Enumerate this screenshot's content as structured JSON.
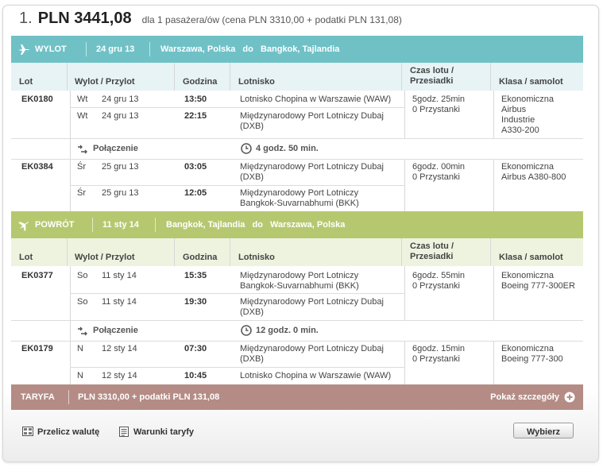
{
  "header": {
    "number": "1.",
    "price": "PLN 3441,08",
    "description": "dla 1 pasażera/ów (cena PLN 3310,00 + podatki PLN 131,08)"
  },
  "outbound": {
    "label": "WYLOT",
    "date": "24 gru 13",
    "from": "Warszawa, Polska",
    "to_word": "do",
    "to": "Bangkok, Tajlandia"
  },
  "inbound": {
    "label": "POWRÓT",
    "date": "11 sty 14",
    "from": "Bangkok, Tajlandia",
    "to_word": "do",
    "to": "Warszawa, Polska"
  },
  "columns": {
    "flight": "Lot",
    "depart_arrive": "Wylot / Przylot",
    "time": "Godzina",
    "airport": "Lotnisko",
    "duration_line1": "Czas lotu /",
    "duration_line2": "Przesiadki",
    "class": "Klasa / samolot"
  },
  "outbound_segments": [
    {
      "flight": "EK0180",
      "dep": {
        "day": "Wt",
        "date": "24 gru 13",
        "time": "13:50",
        "airport": "Lotnisko Chopina w Warszawie (WAW)"
      },
      "arr": {
        "day": "Wt",
        "date": "24 gru 13",
        "time": "22:15",
        "airport_l1": "Międzynarodowy Port Lotniczy Dubaj",
        "airport_l2": "(DXB)"
      },
      "duration": "5godz. 25min",
      "stops": "0 Przystanki",
      "class": "Ekonomiczna",
      "aircraft_l1": "Airbus",
      "aircraft_l2": "Industrie",
      "aircraft_l3": "A330-200"
    },
    {
      "flight": "EK0384",
      "dep": {
        "day": "Śr",
        "date": "25 gru 13",
        "time": "03:05",
        "airport_l1": "Międzynarodowy Port Lotniczy Dubaj",
        "airport_l2": "(DXB)"
      },
      "arr": {
        "day": "Śr",
        "date": "25 gru 13",
        "time": "12:05",
        "airport_l1": "Międzynarodowy Port Lotniczy",
        "airport_l2": "Bangkok-Suvarnabhumi (BKK)"
      },
      "duration": "6godz. 00min",
      "stops": "0 Przystanki",
      "class": "Ekonomiczna",
      "aircraft_l1": "Airbus A380-800"
    }
  ],
  "outbound_connection": {
    "label": "Połączenie",
    "time": "4 godz. 50 min."
  },
  "inbound_segments": [
    {
      "flight": "EK0377",
      "dep": {
        "day": "So",
        "date": "11 sty 14",
        "time": "15:35",
        "airport_l1": "Międzynarodowy Port Lotniczy",
        "airport_l2": "Bangkok-Suvarnabhumi (BKK)"
      },
      "arr": {
        "day": "So",
        "date": "11 sty 14",
        "time": "19:30",
        "airport_l1": "Międzynarodowy Port Lotniczy Dubaj",
        "airport_l2": "(DXB)"
      },
      "duration": "6godz. 55min",
      "stops": "0 Przystanki",
      "class": "Ekonomiczna",
      "aircraft_l1": "Boeing 777-300ER"
    },
    {
      "flight": "EK0179",
      "dep": {
        "day": "N",
        "date": "12 sty 14",
        "time": "07:30",
        "airport_l1": "Międzynarodowy Port Lotniczy Dubaj",
        "airport_l2": "(DXB)"
      },
      "arr": {
        "day": "N",
        "date": "12 sty 14",
        "time": "10:45",
        "airport": "Lotnisko Chopina w Warszawie (WAW)"
      },
      "duration": "6godz. 15min",
      "stops": "0 Przystanki",
      "class": "Ekonomiczna",
      "aircraft_l1": "Boeing 777-300"
    }
  ],
  "inbound_connection": {
    "label": "Połączenie",
    "time": "12 godz. 0 min."
  },
  "tariff": {
    "label": "TARYFA",
    "value": "PLN 3310,00 + podatki PLN 131,08",
    "details_link": "Pokaż szczegóły"
  },
  "footer": {
    "currency_link": "Przelicz walutę",
    "terms_link": "Warunki taryfy",
    "select_button": "Wybierz"
  },
  "colors": {
    "outbound_band": "#6fc1c6",
    "inbound_band": "#b6c86f",
    "tariff_band": "#b48c85"
  }
}
